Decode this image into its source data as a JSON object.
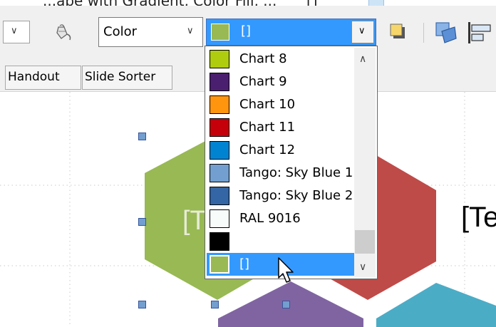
{
  "top_strip": {
    "cut_text": "...ape with Gradient, Color Fill, ...",
    "bracket": "[]"
  },
  "toolbar": {
    "line_style_combo": {
      "chevron": "chevron-down-icon"
    },
    "fill_icon": "paint-bucket-icon",
    "area_style_combo": {
      "value": "Color",
      "chevron": "chevron-down-icon"
    },
    "fill_color_combo": {
      "value": "[]",
      "swatch_color": "#98b954",
      "chevron": "chevron-down-icon"
    },
    "shadow_icon": "shadow-icon",
    "arrange_icon": "arrange-icon",
    "align_icon": "align-icon"
  },
  "tabs": [
    {
      "label": "Handout"
    },
    {
      "label": "Slide Sorter"
    }
  ],
  "dropdown": {
    "items": [
      {
        "label": "Chart 8",
        "color": "#b0cc0e"
      },
      {
        "label": "Chart 9",
        "color": "#4b1f6f"
      },
      {
        "label": "Chart 10",
        "color": "#ff950e"
      },
      {
        "label": "Chart 11",
        "color": "#c5000b"
      },
      {
        "label": "Chart 12",
        "color": "#0084d1"
      },
      {
        "label": "Tango: Sky Blue 1",
        "color": "#729fcf"
      },
      {
        "label": "Tango: Sky Blue 2",
        "color": "#3465a4"
      },
      {
        "label": "RAL 9016",
        "color": "#f7fbfa"
      },
      {
        "label": "",
        "color": "#000000"
      },
      {
        "label": "[]",
        "color": "#98b954",
        "selected": true
      }
    ],
    "scroll_up": "▲",
    "scroll_down": "▼"
  },
  "slide": {
    "hexagons": [
      {
        "color": "#98b954",
        "text": "[Te"
      },
      {
        "color": "#be4b48",
        "text": "[Te"
      },
      {
        "color": "#8064a2",
        "text": ""
      },
      {
        "color": "#4bacc6",
        "text": ""
      }
    ]
  }
}
